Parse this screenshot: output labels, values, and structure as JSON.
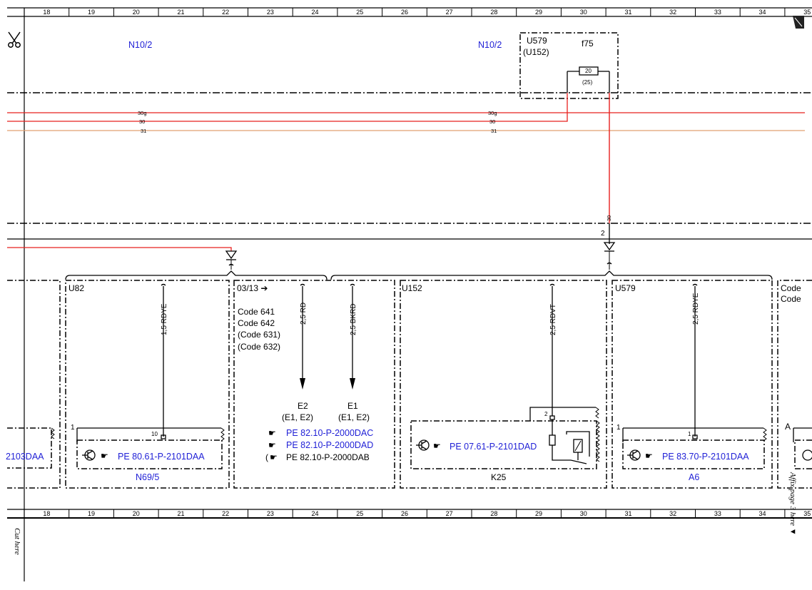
{
  "grid_columns": [
    "18",
    "19",
    "20",
    "21",
    "22",
    "23",
    "24",
    "25",
    "26",
    "27",
    "28",
    "29",
    "30",
    "31",
    "32",
    "33",
    "34",
    "35"
  ],
  "top_labels": {
    "n10_left": "N10/2",
    "n10_right": "N10/2",
    "u579_box": "U579",
    "u152_box": "(U152)",
    "fuse_name": "f75",
    "fuse_value": "20",
    "fuse_sub": "(25)"
  },
  "wires": {
    "w30g": "30g",
    "w30": "30",
    "w31": "31",
    "vert_30": "30",
    "pin2": "2"
  },
  "modules": {
    "u82": "U82",
    "code_panel": "03/13 ➔",
    "code_lines": [
      "Code 641",
      "Code 642",
      "(Code 631)",
      "(Code 632)"
    ],
    "u152": "U152",
    "u579": "U579",
    "right_code_1": "Code",
    "right_code_2": "Code"
  },
  "wire_specs": {
    "rdye_1": "1,5 RDYE",
    "rd": "2,5 RD",
    "bkrd": "2,5 BKRD",
    "rdvt": "2,5 RDVT",
    "rdye_2": "2,5 RDYE"
  },
  "ground_labels": {
    "e2": "E2",
    "e2_sub": "(E1,  E2)",
    "e1": "E1",
    "e1_sub": "(E1,  E2)"
  },
  "references": {
    "left_partial": "2103DAA",
    "pe_80": "PE 80.61-P-2101DAA",
    "pe_82_dac": "PE 82.10-P-2000DAC",
    "pe_82_dad": "PE 82.10-P-2000DAD",
    "pe_82_dab": "PE 82.10-P-2000DAB",
    "pe_07": "PE 07.61-P-2101DAD",
    "pe_83": "PE 83.70-P-2101DAA"
  },
  "components": {
    "n69": "N69/5",
    "k25": "K25",
    "a6": "A6",
    "pin1_left": "1",
    "pin10": "10",
    "pin2_k25": "2",
    "pin1_a6": "1",
    "pin1_a6_conn": "1",
    "right_a": "A"
  },
  "margin_text": {
    "cut_here": "Cut here",
    "affix": "Affix page 3 here ▼"
  },
  "colors": {
    "wire_red": "#e8201e",
    "wire_brown": "#e0a070",
    "ref_blue": "#1f1fd6"
  }
}
